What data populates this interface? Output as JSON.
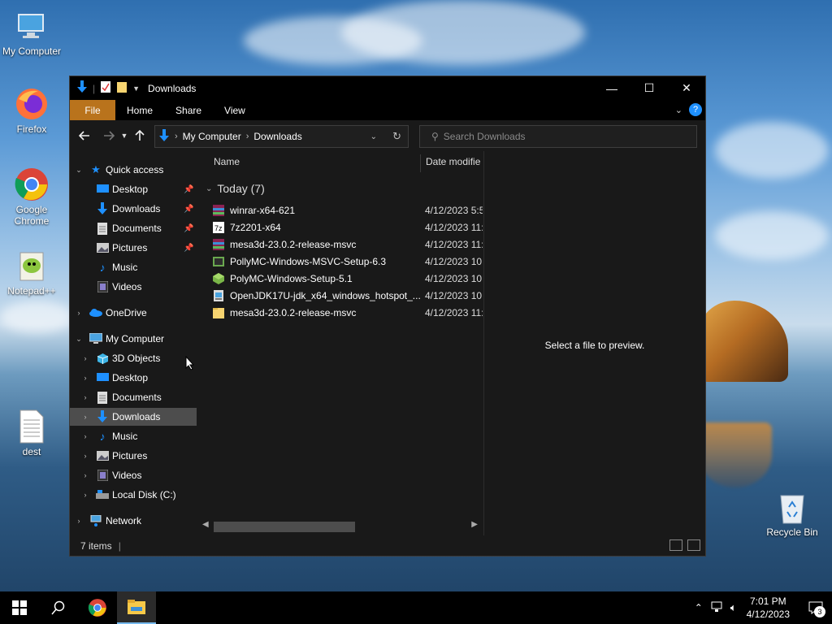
{
  "desktop": {
    "icons": [
      {
        "label": "My Computer",
        "icon": "computer-icon"
      },
      {
        "label": "Firefox",
        "icon": "firefox-icon"
      },
      {
        "label": "Google Chrome",
        "icon": "chrome-icon"
      },
      {
        "label": "Notepad++",
        "icon": "notepadpp-icon"
      },
      {
        "label": "dest",
        "icon": "text-file-icon"
      },
      {
        "label": "Recycle Bin",
        "icon": "recycle-bin-icon"
      }
    ]
  },
  "window": {
    "title": "Downloads",
    "controls": {
      "minimize": "—",
      "maximize": "☐",
      "close": "✕"
    }
  },
  "ribbon": {
    "tabs": [
      "File",
      "Home",
      "Share",
      "View"
    ]
  },
  "address": {
    "segments": [
      "My Computer",
      "Downloads"
    ],
    "search_placeholder": "Search Downloads"
  },
  "navpane": {
    "quick_access": "Quick access",
    "quick_items": [
      "Desktop",
      "Downloads",
      "Documents",
      "Pictures",
      "Music",
      "Videos"
    ],
    "onedrive": "OneDrive",
    "my_computer": "My Computer",
    "computer_items": [
      "3D Objects",
      "Desktop",
      "Documents",
      "Downloads",
      "Music",
      "Pictures",
      "Videos",
      "Local Disk (C:)"
    ],
    "network": "Network"
  },
  "files": {
    "col_name": "Name",
    "col_date": "Date modifie",
    "group": "Today (7)",
    "rows": [
      {
        "name": "winrar-x64-621",
        "date": "4/12/2023 5:5",
        "icon": "winrar-icon"
      },
      {
        "name": "7z2201-x64",
        "date": "4/12/2023 11:",
        "icon": "7zip-icon"
      },
      {
        "name": "mesa3d-23.0.2-release-msvc",
        "date": "4/12/2023 11:",
        "icon": "archive-icon"
      },
      {
        "name": "PollyMC-Windows-MSVC-Setup-6.3",
        "date": "4/12/2023 10:",
        "icon": "installer-icon"
      },
      {
        "name": "PolyMC-Windows-Setup-5.1",
        "date": "4/12/2023 10:",
        "icon": "polymc-icon"
      },
      {
        "name": "OpenJDK17U-jdk_x64_windows_hotspot_...",
        "date": "4/12/2023 10:",
        "icon": "msi-icon"
      },
      {
        "name": "mesa3d-23.0.2-release-msvc",
        "date": "4/12/2023 11:",
        "icon": "folder-icon"
      }
    ]
  },
  "preview": {
    "message": "Select a file to preview."
  },
  "status": {
    "items": "7 items"
  },
  "taskbar": {
    "time": "7:01 PM",
    "date": "4/12/2023",
    "notifications": "3"
  },
  "colors": {
    "file_tab": "#b9731c",
    "selection": "#4d4d4d",
    "accent": "#1e90ff"
  }
}
